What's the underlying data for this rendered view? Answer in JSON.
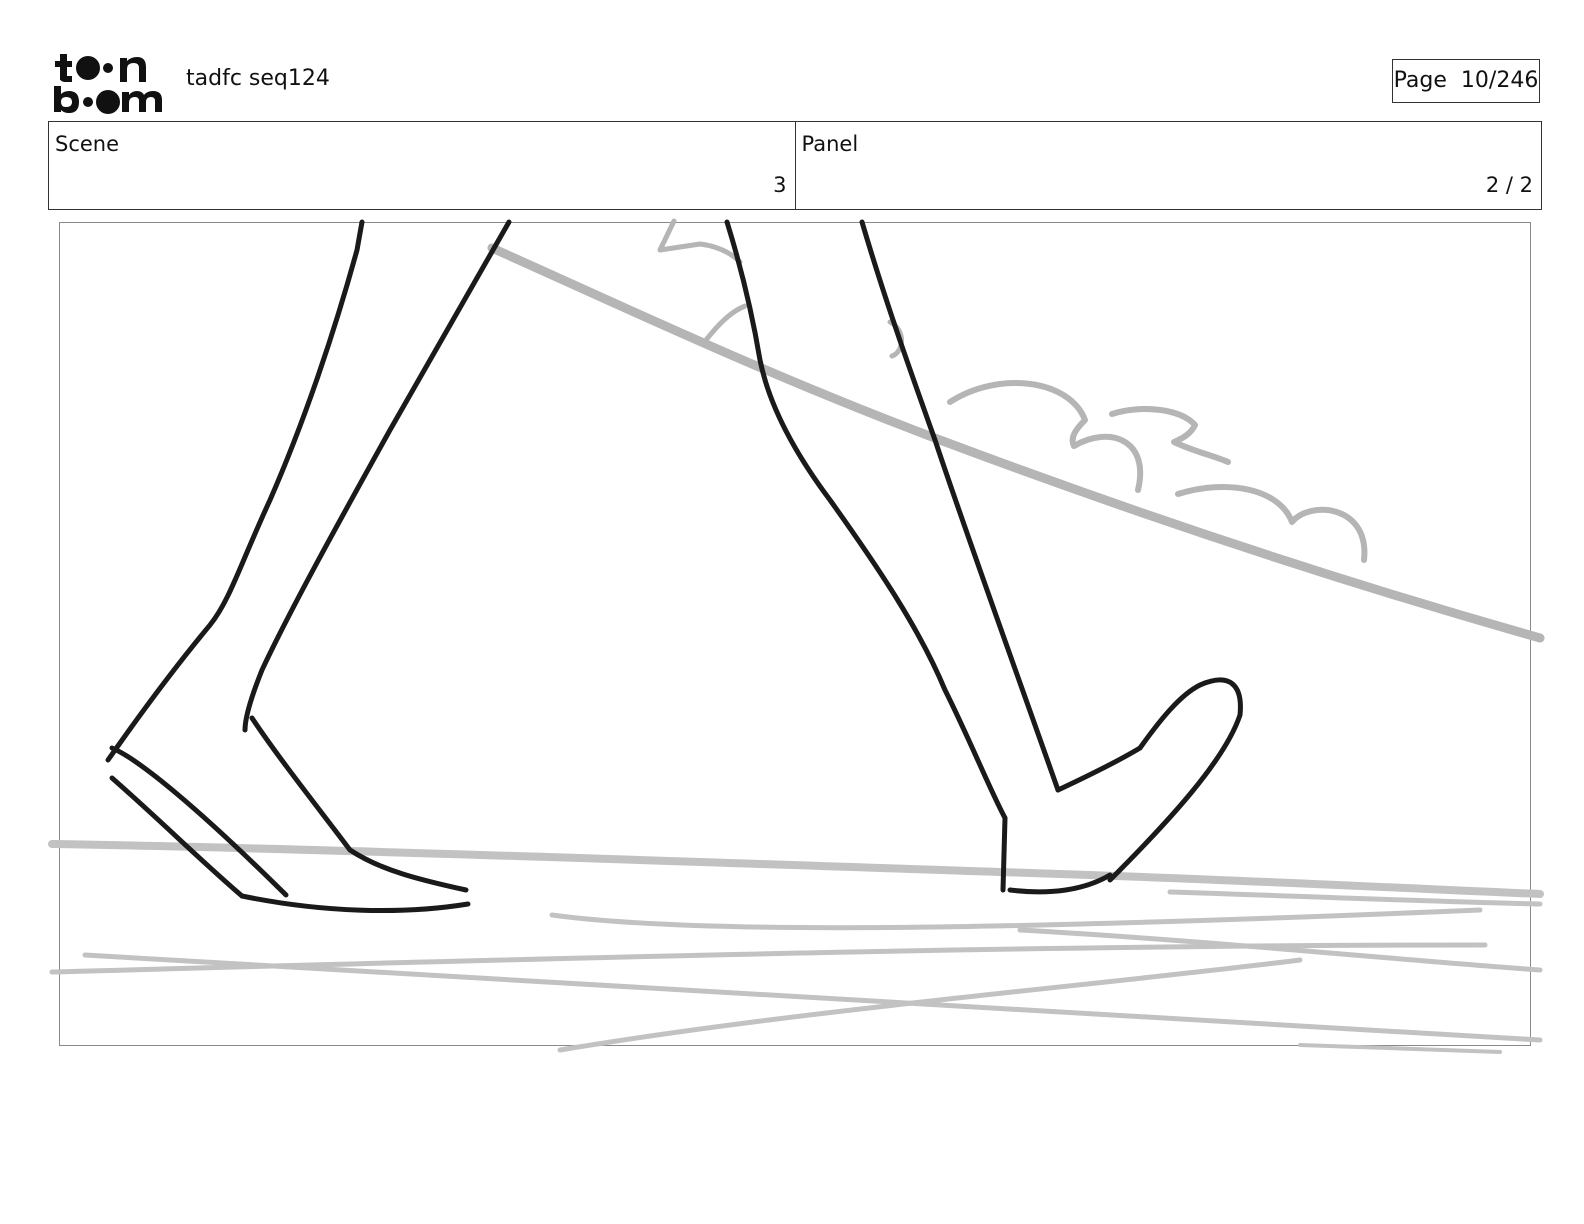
{
  "header": {
    "logo_text": [
      "toon",
      "boom"
    ],
    "sequence_title": "tadfc seq124",
    "page_label": "Page",
    "page_value": "10/246"
  },
  "info": {
    "scene_label": "Scene",
    "scene_value": "3",
    "panel_label": "Panel",
    "panel_value": "2 / 2"
  },
  "colors": {
    "ink": "#1a1a1a",
    "background_sketch": "#b5b5b5",
    "frame_border": "#8a8a8a"
  }
}
